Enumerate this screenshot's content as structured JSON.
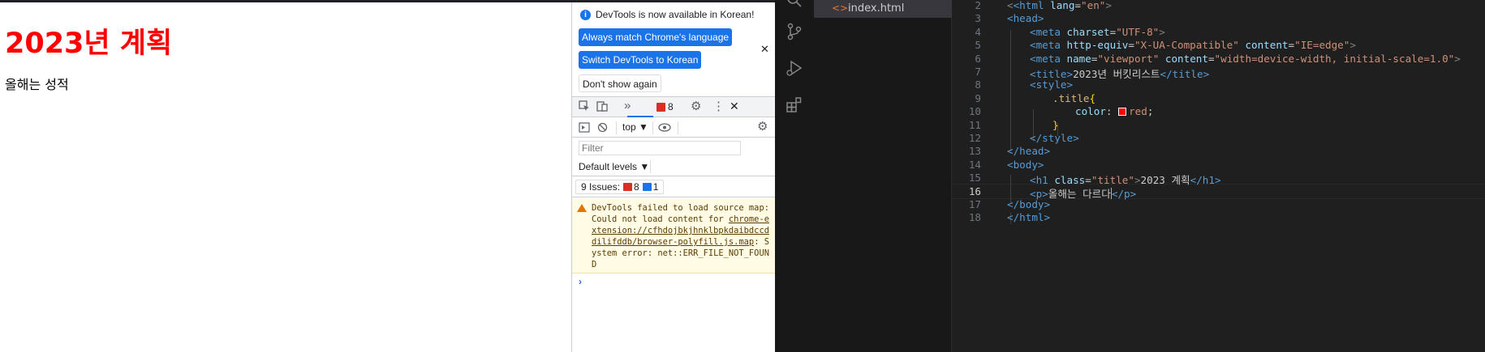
{
  "preview": {
    "h1": "2023년 계획",
    "p": "올해는 성적"
  },
  "devtools": {
    "info_text": "DevTools is now available in Korean!",
    "btn_match": "Always match Chrome's language",
    "btn_switch": "Switch DevTools to Korean",
    "btn_dont": "Don't show again",
    "close_glyph": "✕",
    "issues_badge": "8",
    "context": "top ▼",
    "filter_placeholder": "Filter",
    "levels": "Default levels ▼",
    "issues_label": "9 Issues:",
    "issues_red": "8",
    "issues_blue": "1",
    "warn_prefix": "DevTools failed to load source map: Could not load content for ",
    "warn_link": "chrome-extension://cfhdojbkjhnklbpkdaibdccddilifddb/browser-polyfill.js.map",
    "warn_suffix": ": System error: net::ERR_FILE_NOT_FOUND",
    "prompt": "›",
    "colors": {
      "accent": "#1a73e8",
      "error": "#d93025",
      "warning": "#e37400"
    }
  },
  "editor": {
    "file_icon": "<>",
    "file_name": "index.html",
    "line_numbers": [
      "2",
      "3",
      "4",
      "5",
      "6",
      "7",
      "8",
      "9",
      "10",
      "11",
      "12",
      "13",
      "14",
      "15",
      "16",
      "17",
      "18"
    ],
    "current_line": "16",
    "code": {
      "l2_tag": "<html",
      "l2_attr": "lang",
      "l2_val": "\"en\"",
      "l2_close": ">",
      "l3": "<head>",
      "l4_tag": "<meta",
      "l4_attr": "charset",
      "l4_val": "\"UTF-8\"",
      "l5_tag": "<meta",
      "l5_attr": "http-equiv",
      "l5_val": "\"X-UA-Compatible\"",
      "l5_attr2": "content",
      "l5_val2": "\"IE=edge\"",
      "l6_tag": "<meta",
      "l6_attr": "name",
      "l6_val": "\"viewport\"",
      "l6_attr2": "content",
      "l6_val2": "\"width=device-width, initial-scale=1.0\"",
      "l7_open": "<title>",
      "l7_text": "2023년 버킷리스트",
      "l7_close": "</title>",
      "l8": "<style>",
      "l9_sel": ".title",
      "l9_brace": "{",
      "l10_prop": "color",
      "l10_val": "red",
      "l11_brace": "}",
      "l12": "</style>",
      "l13": "</head>",
      "l14": "<body>",
      "l15_tag": "<h1",
      "l15_attr": "class",
      "l15_val": "\"title\"",
      "l15_text": "2023 계획",
      "l15_close": "</h1>",
      "l16_open": "<p>",
      "l16_text": "올해는 다르다",
      "l16_close": "</p>",
      "l17": "</body>",
      "l18": "</html>"
    }
  }
}
